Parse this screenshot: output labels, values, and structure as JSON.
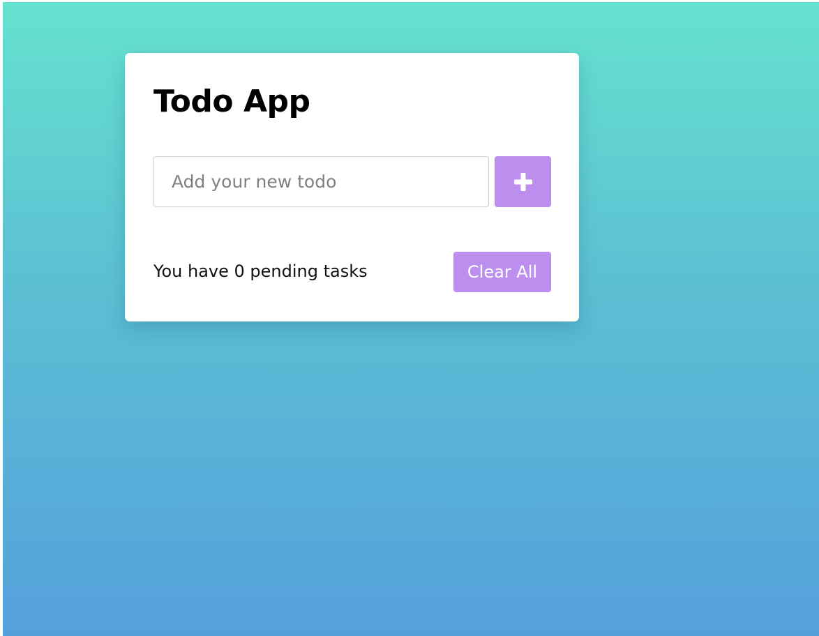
{
  "app": {
    "title": "Todo App"
  },
  "input": {
    "value": "",
    "placeholder": "Add your new todo"
  },
  "add_button": {
    "icon": "plus-icon"
  },
  "footer": {
    "pending_prefix": "You have ",
    "pending_count": "0",
    "pending_suffix": " pending tasks",
    "clear_label": "Clear All"
  },
  "colors": {
    "accent": "#bc8fef",
    "gradient_top": "#65e2cf",
    "gradient_bottom": "#55a0dc",
    "card_background": "#ffffff"
  }
}
